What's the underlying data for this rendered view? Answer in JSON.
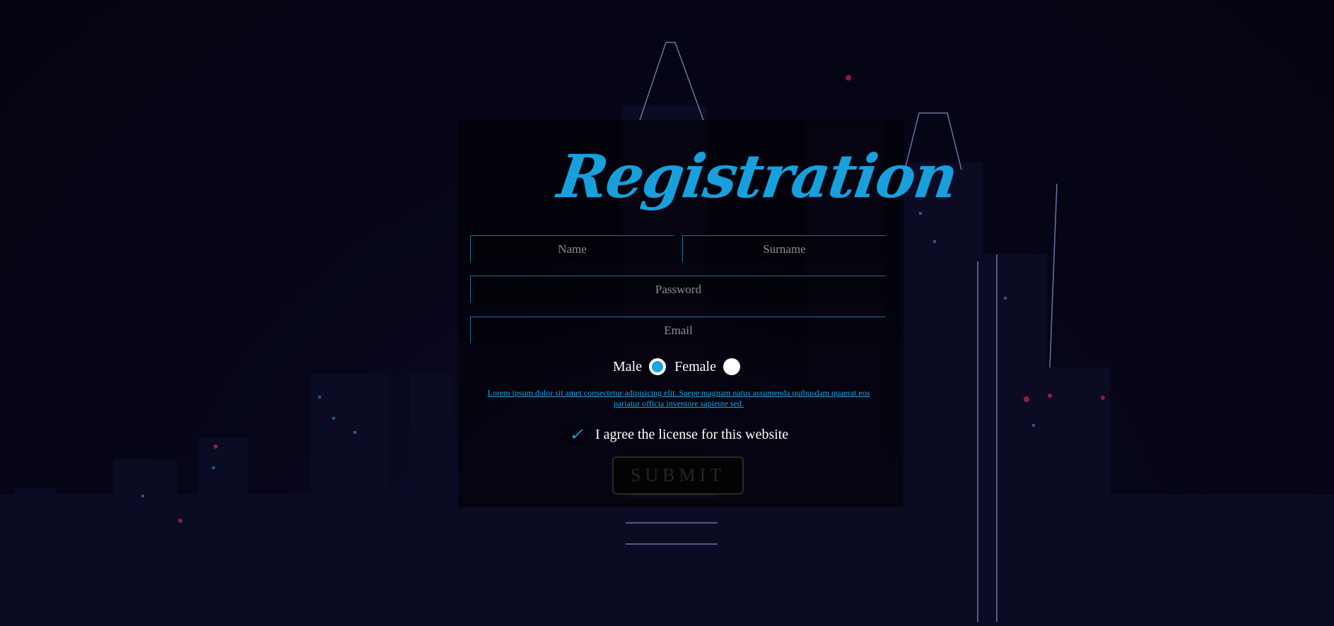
{
  "logo": {
    "text": "Registration"
  },
  "form": {
    "name_placeholder": "Name",
    "surname_placeholder": "Surname",
    "password_placeholder": "Password",
    "email_placeholder": "Email",
    "gender": {
      "options": [
        "Male",
        "Female"
      ],
      "selected": "Male"
    },
    "terms_text": "Lorem ipsum dolor sit amet consectetur adipisicing elit. Saepe magnam natus assumenda quibusdam quaerat eos pariatur officia inventore sapiente sed.",
    "agree_label": "I agree the license for this website",
    "agree_checked": true,
    "submit_label": "SUBMIT"
  },
  "colors": {
    "accent": "#1ba5e0",
    "background": "#05040f",
    "field_border": "#1d6f9a"
  }
}
